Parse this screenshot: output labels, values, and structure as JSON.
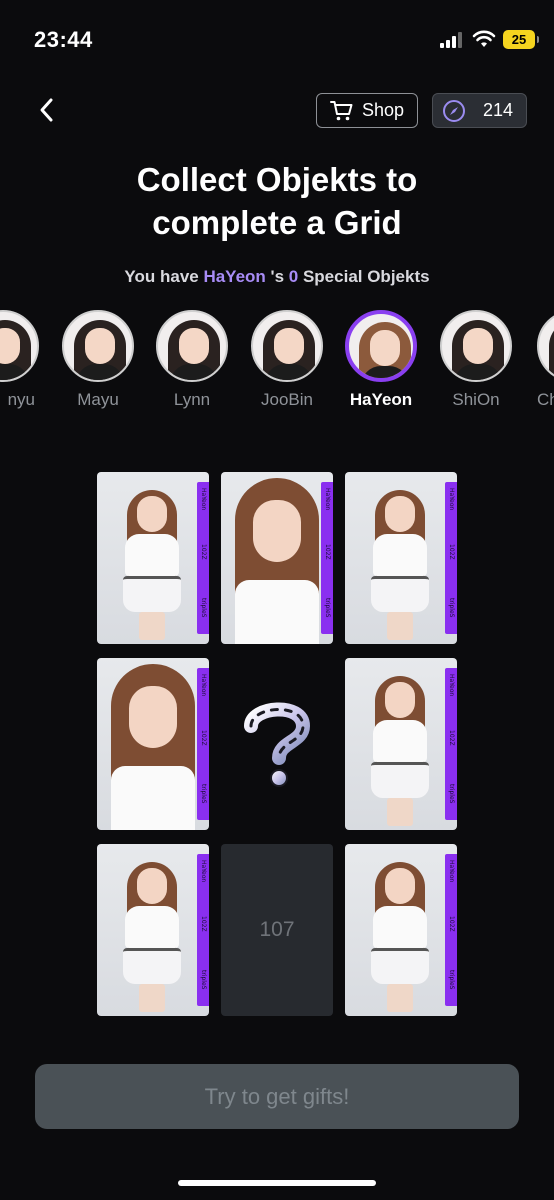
{
  "status_bar": {
    "time": "23:44",
    "battery": "25"
  },
  "header": {
    "shop_label": "Shop",
    "coin_balance": "214"
  },
  "title_line1": "Collect Objekts to",
  "title_line2": "complete a Grid",
  "subtitle": {
    "prefix": "You have ",
    "member": "HaYeon",
    "middle": " 's ",
    "count": "0",
    "suffix": " Special Objekts"
  },
  "members": [
    {
      "name": "nyu"
    },
    {
      "name": "Mayu"
    },
    {
      "name": "Lynn"
    },
    {
      "name": "JooBin"
    },
    {
      "name": "HaYeon",
      "active": true
    },
    {
      "name": "ShiOn"
    },
    {
      "name": "Ch"
    }
  ],
  "card_stripe": {
    "top": "HaYeon",
    "middle": "102Z",
    "bottom": "tripleS"
  },
  "grid": {
    "placeholder_number": "107"
  },
  "cta_label": "Try to get gifts!",
  "colors": {
    "accent": "#a88cf6",
    "active_ring": "#8a3ff0",
    "stripe": "#8a2ff0",
    "button_bg": "#4a5156"
  }
}
